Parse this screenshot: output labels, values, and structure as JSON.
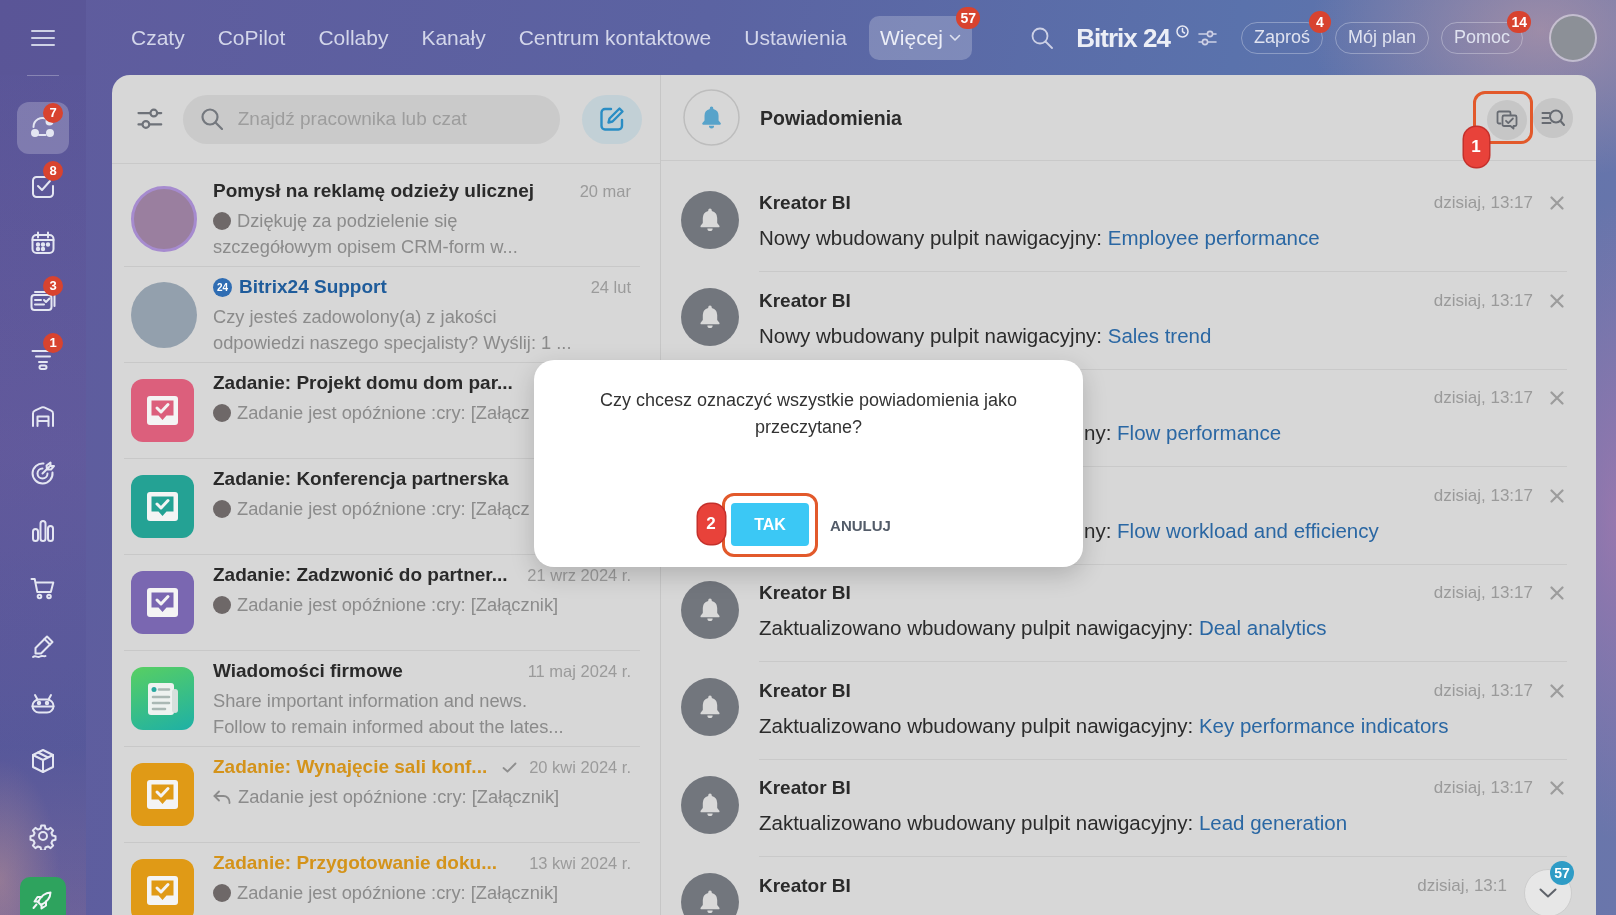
{
  "top_bar": {
    "nav": [
      {
        "label": "Czaty",
        "selected": false
      },
      {
        "label": "CoPilot",
        "selected": false
      },
      {
        "label": "Collaby",
        "selected": false
      },
      {
        "label": "Kanały",
        "selected": false
      },
      {
        "label": "Centrum kontaktowe",
        "selected": false
      },
      {
        "label": "Ustawienia",
        "selected": false
      },
      {
        "label": "Więcej",
        "selected": true,
        "badge": "57"
      }
    ],
    "logo": "Bitrix 24",
    "buttons": [
      {
        "label": "Zaproś",
        "badge": "4"
      },
      {
        "label": "Mój plan"
      },
      {
        "label": "Pomoc",
        "badge": "14"
      }
    ]
  },
  "sidebar": {
    "items": [
      {
        "kind": "chats",
        "selected": true,
        "badge": "7"
      },
      {
        "kind": "tasks",
        "selected": false,
        "badge": "8"
      },
      {
        "kind": "calendar",
        "selected": false
      },
      {
        "kind": "crm",
        "selected": false,
        "badge": "3"
      },
      {
        "kind": "funnel",
        "selected": false,
        "badge": "1"
      },
      {
        "kind": "garage",
        "selected": false
      },
      {
        "kind": "goals",
        "selected": false
      },
      {
        "kind": "analytics",
        "selected": false
      },
      {
        "kind": "shop",
        "selected": false
      },
      {
        "kind": "sign",
        "selected": false
      },
      {
        "kind": "bot",
        "selected": false
      },
      {
        "kind": "cube",
        "selected": false
      }
    ],
    "bottom_items": [
      {
        "kind": "settings",
        "selected": false
      },
      {
        "kind": "rocket",
        "selected": false
      }
    ]
  },
  "chat_list": {
    "search": {
      "placeholder": "Znajdź pracownika lub czat"
    },
    "items": [
      {
        "kind": "photo",
        "title": "Pomysł na reklamę odzieży ulicznej",
        "date": "20 mar",
        "highlighted": false,
        "read": false,
        "preview": {
          "kind": "avatar",
          "lines": [
            "Dziękuję za podzielenie się",
            "szczegółowym opisem CRM-form w..."
          ]
        }
      },
      {
        "kind": "photo",
        "title": "Bitrix24 Support",
        "title_badge": "24",
        "date": "24 lut",
        "highlighted": false,
        "read": false,
        "preview": {
          "kind": "plain",
          "lines": [
            "Czy jesteś zadowolony(a) z jakości",
            "odpowiedzi naszego specjalisty? Wyślij: 1 ..."
          ]
        }
      },
      {
        "kind": "task",
        "color": "#dc5f7c",
        "title": "Zadanie: Projekt domu dom par...",
        "highlighted": false,
        "read": false,
        "preview": {
          "kind": "avatar",
          "lines": [
            "Zadanie jest opóźnione :cry: [Załącz"
          ]
        }
      },
      {
        "kind": "task",
        "color": "#24a294",
        "title": "Zadanie: Konferencja partnerska",
        "highlighted": false,
        "read": false,
        "preview": {
          "kind": "avatar",
          "lines": [
            "Zadanie jest opóźnione :cry: [Załącz"
          ]
        }
      },
      {
        "kind": "task",
        "color": "#7a67b1",
        "title": "Zadanie: Zadzwonić do partner...",
        "date": "21 wrz 2024 r.",
        "highlighted": false,
        "read": false,
        "preview": {
          "kind": "avatar",
          "lines": [
            "Zadanie jest opóźnione :cry: [Załącznik]"
          ]
        }
      },
      {
        "kind": "news",
        "title": "Wiadomości firmowe",
        "date": "11 maj 2024 r.",
        "highlighted": false,
        "read": false,
        "preview": {
          "kind": "plain",
          "lines": [
            "Share important information and news.",
            "Follow to remain informed about the lates..."
          ]
        }
      },
      {
        "kind": "task",
        "color": "#e09a16",
        "title": "Zadanie: Wynajęcie sali konf...",
        "date": "20 kwi 2024 r.",
        "highlighted": true,
        "read": true,
        "preview": {
          "kind": "reply",
          "lines": [
            "Zadanie jest opóźnione :cry: [Załącznik]"
          ]
        }
      },
      {
        "kind": "task",
        "color": "#e09a16",
        "title": "Zadanie: Przygotowanie doku...",
        "date": "13 kwi 2024 r.",
        "highlighted": true,
        "read": false,
        "preview": {
          "kind": "avatar",
          "lines": [
            "Zadanie jest opóźnione :cry: [Załącznik]"
          ]
        }
      }
    ]
  },
  "notifications": {
    "title": "Powiadomienia",
    "header_actions": [
      {
        "kind": "mark_read",
        "callout": "1"
      },
      {
        "kind": "search"
      }
    ],
    "items": [
      {
        "title": "Kreator BI",
        "time": "dzisiaj, 13:17",
        "dismissible": true,
        "message": "Nowy wbudowany pulpit nawigacyjny:",
        "link": "Employee performance"
      },
      {
        "title": "Kreator BI",
        "time": "dzisiaj, 13:17",
        "dismissible": true,
        "message": "Nowy wbudowany pulpit nawigacyjny:",
        "link": "Sales trend"
      },
      {
        "time": "dzisiaj, 13:17",
        "dismissible": true,
        "message": "ny:",
        "link": "Flow performance"
      },
      {
        "time": "dzisiaj, 13:17",
        "dismissible": true,
        "message": "ny:",
        "link": "Flow workload and efficiency"
      },
      {
        "title": "Kreator BI",
        "time": "dzisiaj, 13:17",
        "dismissible": true,
        "message": "Zaktualizowano wbudowany pulpit nawigacyjny:",
        "link": "Deal analytics"
      },
      {
        "title": "Kreator BI",
        "time": "dzisiaj, 13:17",
        "dismissible": true,
        "message": "Zaktualizowano wbudowany pulpit nawigacyjny:",
        "link": "Key performance indicators"
      },
      {
        "title": "Kreator BI",
        "time": "dzisiaj, 13:17",
        "dismissible": true,
        "message": "Zaktualizowano wbudowany pulpit nawigacyjny:",
        "link": "Lead generation"
      },
      {
        "title": "Kreator BI",
        "time": "dzisiaj, 13:1",
        "dismissible": false
      }
    ],
    "scroll_button": {
      "badge": "57"
    }
  },
  "dialog": {
    "message": "Czy chcesz oznaczyć wszystkie powiadomienia jako przeczytane?",
    "buttons": [
      {
        "kind": "primary",
        "label": "TAK",
        "callout": "2"
      },
      {
        "kind": "secondary",
        "label": "ANULUJ"
      }
    ]
  }
}
